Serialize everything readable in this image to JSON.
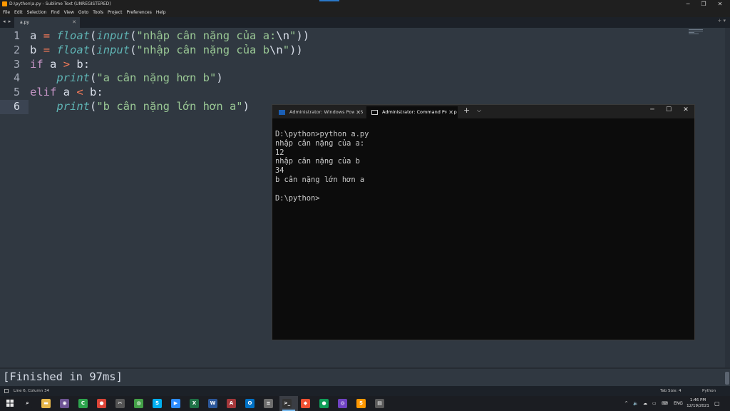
{
  "window": {
    "title": "D:\\python\\a.py - Sublime Text (UNREGISTERED)",
    "controls": [
      "─",
      "❐",
      "✕"
    ]
  },
  "menu": [
    "File",
    "Edit",
    "Selection",
    "Find",
    "View",
    "Goto",
    "Tools",
    "Project",
    "Preferences",
    "Help"
  ],
  "tabs": {
    "nav": "◂ ▸",
    "file": "a.py",
    "close": "✕",
    "right": "+ ▾"
  },
  "editor": {
    "line_numbers": [
      "1",
      "2",
      "3",
      "4",
      "5",
      "6"
    ],
    "current_line": 6,
    "code": {
      "l1": {
        "var": "a",
        "eq": "=",
        "float": "float",
        "p1": "(",
        "input": "input",
        "p2": "(",
        "str": "\"nhập cân nặng của a:",
        "esc": "\\n",
        "strend": "\"",
        "close": "))"
      },
      "l2": {
        "var": "b",
        "eq": "=",
        "float": "float",
        "p1": "(",
        "input": "input",
        "p2": "(",
        "str": "\"nhập cân nặng của b",
        "esc": "\\n",
        "strend": "\"",
        "close": "))"
      },
      "l3": {
        "kw": "if",
        "a": "a",
        "op": ">",
        "b": "b:"
      },
      "l4": {
        "indent": "    ",
        "fn": "print",
        "p": "(",
        "str": "\"a cân nặng hơn b\"",
        "close": ")"
      },
      "l5": {
        "kw": "elif",
        "a": "a",
        "op": "<",
        "b": "b:"
      },
      "l6": {
        "indent": "    ",
        "fn": "print",
        "p": "(",
        "str": "\"b cân nặng lớn hơn a\"",
        "close": ")"
      }
    }
  },
  "output_panel": {
    "text": "[Finished in 97ms]"
  },
  "status_bar": {
    "position": "Line 6, Column 34",
    "tab_size": "Tab Size: 4",
    "syntax": "Python"
  },
  "terminal": {
    "tabs": [
      {
        "label": "Administrator: Windows PowerS",
        "close": "✕",
        "icon": "powershell-icon"
      },
      {
        "label": "Administrator: Command Promp",
        "close": "✕",
        "icon": "cmd-icon"
      }
    ],
    "new_tab": "+",
    "dropdown": "⌵",
    "controls": [
      "─",
      "☐",
      "✕"
    ],
    "lines": [
      "D:\\python>python a.py",
      "nhập cân nặng của a:",
      "12",
      "nhập cân nặng của b",
      "34",
      "b cân nặng lớn hơn a",
      "",
      "D:\\python>"
    ]
  },
  "taskbar": {
    "start_icon": "windows-start-icon",
    "apps": [
      {
        "name": "search-icon",
        "glyph": "⌕",
        "color": "#1b1d22"
      },
      {
        "name": "file-explorer-icon",
        "glyph": "▬",
        "color": "#e8b84a"
      },
      {
        "name": "github-desktop-icon",
        "glyph": "◉",
        "color": "#6e5494"
      },
      {
        "name": "camtasia-icon",
        "glyph": "C",
        "color": "#2da44e"
      },
      {
        "name": "chrome-icon",
        "glyph": "●",
        "color": "#db4437"
      },
      {
        "name": "snipping-icon",
        "glyph": "✂",
        "color": "#555"
      },
      {
        "name": "greenshot-icon",
        "glyph": "◍",
        "color": "#43a047"
      },
      {
        "name": "skype-icon",
        "glyph": "S",
        "color": "#00aff0"
      },
      {
        "name": "zoom-icon",
        "glyph": "▶",
        "color": "#2d8cff"
      },
      {
        "name": "excel-icon",
        "glyph": "X",
        "color": "#1e7145"
      },
      {
        "name": "word-icon",
        "glyph": "W",
        "color": "#2b579a"
      },
      {
        "name": "access-icon",
        "glyph": "A",
        "color": "#a4373a"
      },
      {
        "name": "outlook-icon",
        "glyph": "O",
        "color": "#0072c6"
      },
      {
        "name": "notepad-icon",
        "glyph": "≡",
        "color": "#6d6d6d"
      },
      {
        "name": "terminal-icon",
        "glyph": ">_",
        "color": "#333"
      },
      {
        "name": "git-icon",
        "glyph": "◆",
        "color": "#f05032"
      },
      {
        "name": "chrome-alt-icon",
        "glyph": "●",
        "color": "#0f9d58"
      },
      {
        "name": "github-icon",
        "glyph": "◎",
        "color": "#6f42c1"
      },
      {
        "name": "sublime-icon",
        "glyph": "S",
        "color": "#ff9800"
      },
      {
        "name": "network-icon",
        "glyph": "▤",
        "color": "#5a5a5a"
      }
    ],
    "tray": {
      "chevron": "^",
      "lang": "ENG",
      "time": "1:46 PM",
      "date": "12/19/2021"
    }
  },
  "colors": {
    "editor_bg": "#303841",
    "keyword": "#c594c5",
    "function": "#5fb4b4",
    "string": "#99c794",
    "operator": "#f97b58",
    "terminal_bg": "#0c0c0c"
  }
}
